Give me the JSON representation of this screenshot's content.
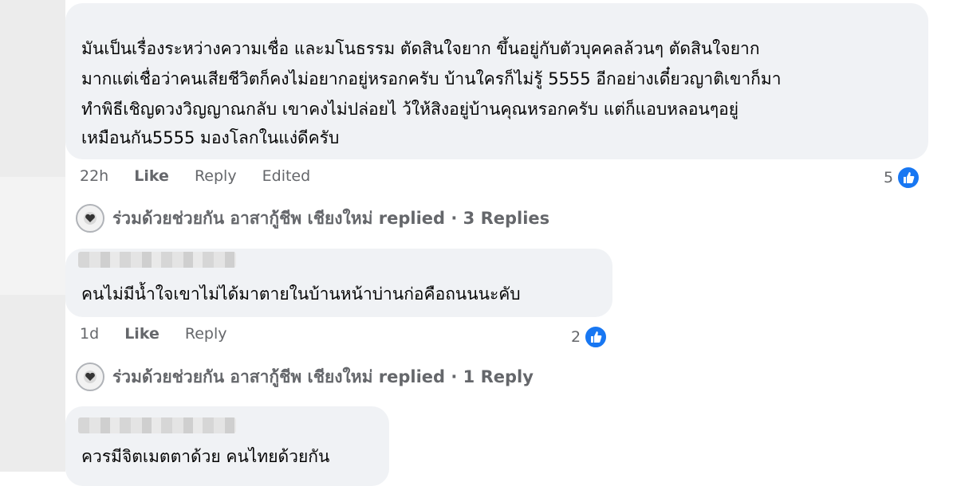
{
  "comments": [
    {
      "text_lines": [
        "มันเป็นเรื่องระหว่างความเชื่อ และมโนธรรม ตัดสินใจยาก ขึ้นอยู่กับตัวบุคคลล้วนๆ ตัดสินใจยาก",
        "มากแต่เชื่อว่าคนเสียชีวิตก็คงไม่อยากอยู่หรอกครับ บ้านใครก็ไม่รู้ 5555 อีกอย่างเดี๋ยวญาติเขาก็มา",
        "ทำพิธีเชิญดวงวิญญาณกลับ เขาคงไม่ปล่อยไ ว้ให้สิงอยู่บ้านคุณหรอกครับ แต่ก็แอบหลอนๆอยู่",
        "เหมือนกัน5555 มองโลกในแง่ดีครับ"
      ],
      "time": "22h",
      "like_label": "Like",
      "reply_label": "Reply",
      "edited_label": "Edited",
      "reaction_count": "5",
      "replies_text": "ร่วมด้วยช่วยกัน อาสากู้ชีพ เชียงใหม่ replied · 3 Replies"
    },
    {
      "text_lines": [
        "คนไม่มีน้ำใจเขาไม่ได้มาตายในบ้านหน้าบ่านก่อคือถนนนะคับ"
      ],
      "time": "1d",
      "like_label": "Like",
      "reply_label": "Reply",
      "reaction_count": "2",
      "replies_text": "ร่วมด้วยช่วยกัน อาสากู้ชีพ เชียงใหม่ replied · 1 Reply"
    },
    {
      "text_lines": [
        "ควรมีจิตเมตตาด้วย คนไทยด้วยกัน"
      ]
    }
  ],
  "colors": {
    "bubble": "#f0f2f5",
    "like_blue": "#1877f2",
    "meta_gray": "#65676b"
  },
  "icons": {
    "reaction": "like-thumb-icon",
    "reply_avatar": "heart-badge-avatar-icon"
  }
}
